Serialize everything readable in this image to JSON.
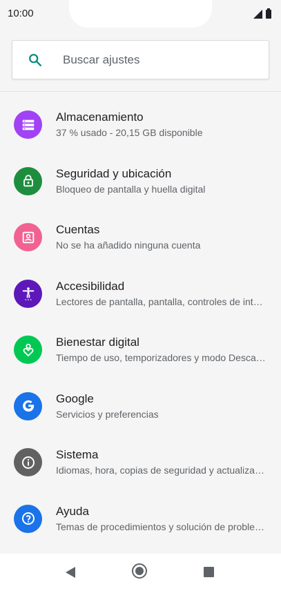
{
  "status_bar": {
    "time": "10:00"
  },
  "search": {
    "placeholder": "Buscar ajustes",
    "icon": "search-icon",
    "icon_color": "#00897b"
  },
  "settings": {
    "items": [
      {
        "title": "Almacenamiento",
        "subtitle": "37 % usado - 20,15 GB disponible",
        "icon": "storage-icon",
        "color": "#a142f4"
      },
      {
        "title": "Seguridad y ubicación",
        "subtitle": "Bloqueo de pantalla y huella digital",
        "icon": "lock-icon",
        "color": "#1e8e3e"
      },
      {
        "title": "Cuentas",
        "subtitle": "No se ha añadido ninguna cuenta",
        "icon": "account-icon",
        "color": "#f06292"
      },
      {
        "title": "Accesibilidad",
        "subtitle": "Lectores de pantalla, pantalla, controles de interacción",
        "icon": "accessibility-icon",
        "color": "#5e17b8"
      },
      {
        "title": "Bienestar digital",
        "subtitle": "Tiempo de uso, temporizadores y modo Descanso",
        "icon": "wellbeing-icon",
        "color": "#00c853"
      },
      {
        "title": "Google",
        "subtitle": "Servicios y preferencias",
        "icon": "google-icon",
        "color": "#1a73e8"
      },
      {
        "title": "Sistema",
        "subtitle": "Idiomas, hora, copias de seguridad y actualizaciones",
        "icon": "info-icon",
        "color": "#616161"
      },
      {
        "title": "Ayuda",
        "subtitle": "Temas de procedimientos y solución de problemas",
        "icon": "help-icon",
        "color": "#1a73e8"
      }
    ]
  },
  "nav_bar": {
    "back": "back-icon",
    "home": "home-icon",
    "recents": "recents-icon"
  }
}
